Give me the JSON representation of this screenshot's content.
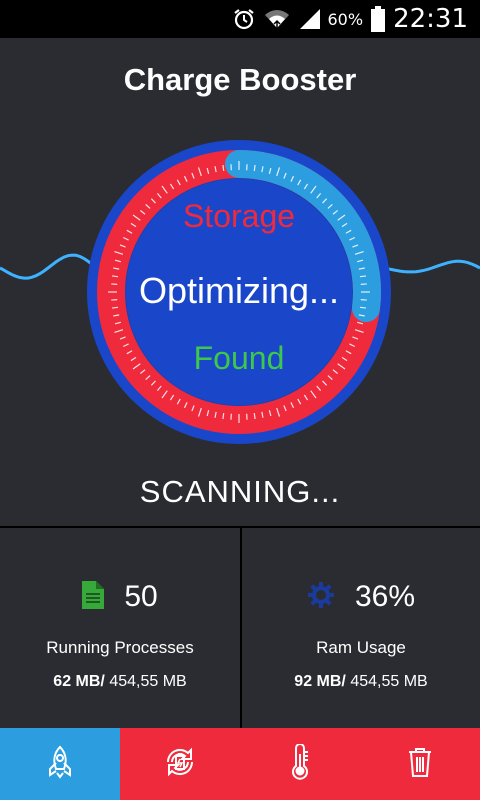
{
  "status_bar": {
    "battery_text": "60%",
    "time": "22:31",
    "icons": [
      "alarm-icon",
      "wifi-icon",
      "signal-icon",
      "battery-icon"
    ]
  },
  "app": {
    "title": "Charge Booster"
  },
  "gauge": {
    "top_label": "Storage",
    "center_label": "Optimizing...",
    "bottom_label": "Found",
    "progress": 0.27,
    "colors": {
      "outer": "#1a47c9",
      "ring": "#ef2a3d",
      "progress": "#2c9ee0",
      "inner": "#1a47c9"
    }
  },
  "status_text": "SCANNING...",
  "stats": {
    "processes": {
      "value": "50",
      "label": "Running Processes",
      "used": "62 MB/",
      "total": " 454,55 MB",
      "icon": "document-icon"
    },
    "ram": {
      "value": "36%",
      "label": "Ram Usage",
      "used": "92 MB/",
      "total": " 454,55 MB",
      "icon": "gear-icon"
    }
  },
  "nav": {
    "items": [
      {
        "icon": "rocket-icon",
        "active": true
      },
      {
        "icon": "battery-refresh-icon",
        "active": false
      },
      {
        "icon": "thermometer-icon",
        "active": false
      },
      {
        "icon": "trash-icon",
        "active": false
      }
    ],
    "colors": {
      "active": "#2c9ee0",
      "inactive": "#ef2a3d"
    }
  }
}
